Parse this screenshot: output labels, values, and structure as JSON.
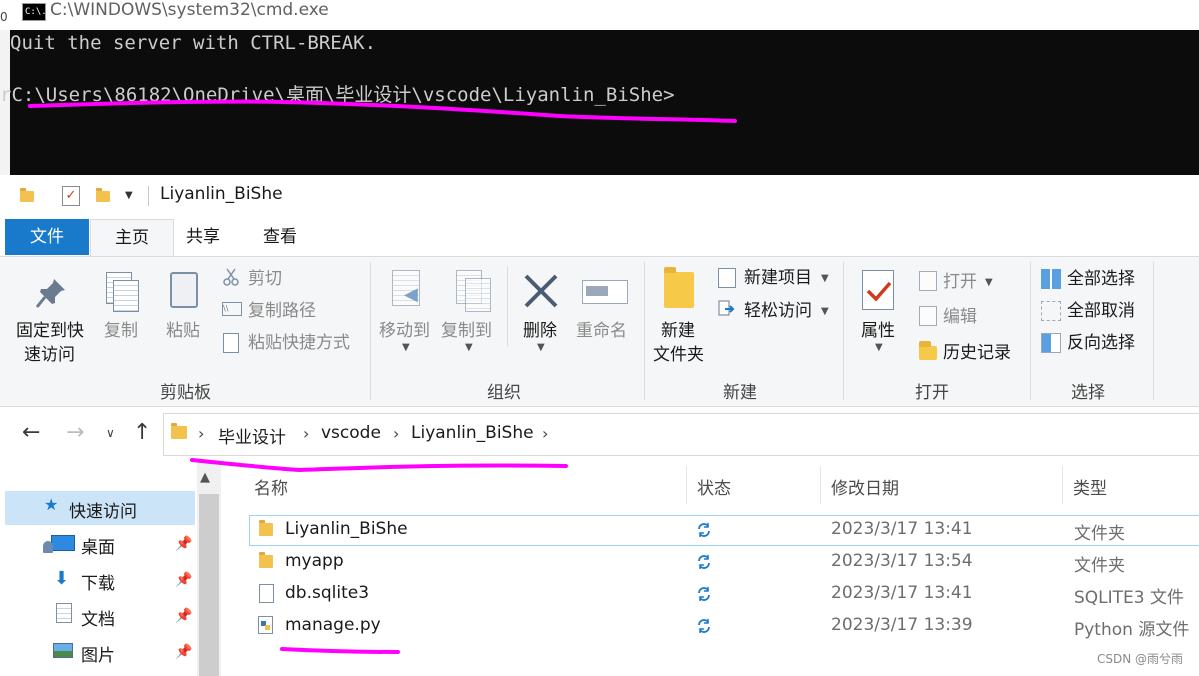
{
  "cmd": {
    "title": "C:\\WINDOWS\\system32\\cmd.exe",
    "icon_text": "C:\\.",
    "edge_char": "0",
    "line1": "Quit the server with CTRL-BREAK.",
    "line2": "rC:\\Users\\86182\\OneDrive\\桌面\\毕业设计\\vscode\\Liyanlin_BiShe>"
  },
  "explorer": {
    "title": "Liyanlin_BiShe",
    "tabs": {
      "file": "文件",
      "home": "主页",
      "share": "共享",
      "view": "查看"
    },
    "ribbon": {
      "clipboard": {
        "pin_l1": "固定到快",
        "pin_l2": "速访问",
        "copy": "复制",
        "paste": "粘贴",
        "cut": "剪切",
        "copy_path": "复制路径",
        "paste_shortcut": "粘贴快捷方式",
        "label": "剪贴板"
      },
      "organize": {
        "move_to": "移动到",
        "copy_to": "复制到",
        "delete": "删除",
        "rename": "重命名",
        "label": "组织"
      },
      "new": {
        "new_item": "新建项目",
        "easy_access": "轻松访问",
        "new_folder_l1": "新建",
        "new_folder_l2": "文件夹",
        "label": "新建"
      },
      "open": {
        "properties": "属性",
        "open": "打开",
        "edit": "编辑",
        "history": "历史记录",
        "label": "打开"
      },
      "select": {
        "select_all": "全部选择",
        "select_none": "全部取消",
        "invert": "反向选择",
        "label": "选择"
      }
    },
    "breadcrumb": [
      "毕业设计",
      "vscode",
      "Liyanlin_BiShe"
    ],
    "nav_pane": [
      {
        "label": "快速访问"
      },
      {
        "label": "桌面"
      },
      {
        "label": "下载"
      },
      {
        "label": "文档"
      },
      {
        "label": "图片"
      }
    ],
    "columns": {
      "name": "名称",
      "status": "状态",
      "modified": "修改日期",
      "type": "类型"
    },
    "files": [
      {
        "name": "Liyanlin_BiShe",
        "modified": "2023/3/17 13:41",
        "type": "文件夹",
        "icon": "folder-icon"
      },
      {
        "name": "myapp",
        "modified": "2023/3/17 13:54",
        "type": "文件夹",
        "icon": "folder-icon"
      },
      {
        "name": "db.sqlite3",
        "modified": "2023/3/17 13:41",
        "type": "SQLITE3 文件",
        "icon": "file-icon"
      },
      {
        "name": "manage.py",
        "modified": "2023/3/17 13:39",
        "type": "Python 源文件",
        "icon": "python-file-icon"
      }
    ]
  },
  "watermark": "CSDN @雨兮雨",
  "colors": {
    "annotation": "#ff00ff",
    "file_tab": "#1979ca",
    "selection": "#cce4f7",
    "console_bg": "#0c0c0c"
  }
}
